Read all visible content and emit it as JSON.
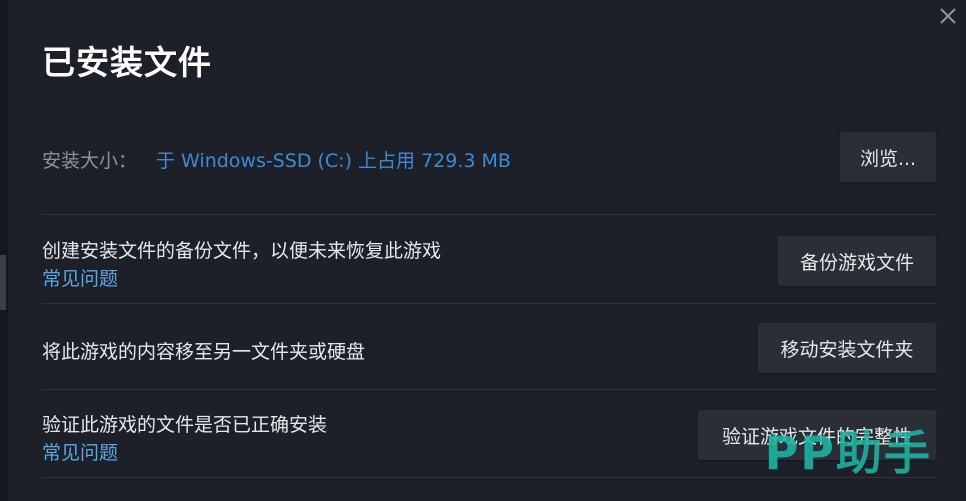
{
  "dialog": {
    "title": "已安装文件",
    "close_icon": "close-icon"
  },
  "install_size": {
    "label": "安装大小：",
    "value": "于 Windows-SSD (C:) 上占用 729.3 MB",
    "browse_label": "浏览..."
  },
  "backup": {
    "description": "创建安装文件的备份文件，以便未来恢复此游戏",
    "faq_label": "常见问题",
    "button_label": "备份游戏文件"
  },
  "move": {
    "description": "将此游戏的内容移至另一文件夹或硬盘",
    "button_label": "移动安装文件夹"
  },
  "verify": {
    "description": "验证此游戏的文件是否已正确安装",
    "faq_label": "常见问题",
    "button_label": "验证游戏文件的完整性"
  },
  "watermark": {
    "text": "PP助手"
  }
}
